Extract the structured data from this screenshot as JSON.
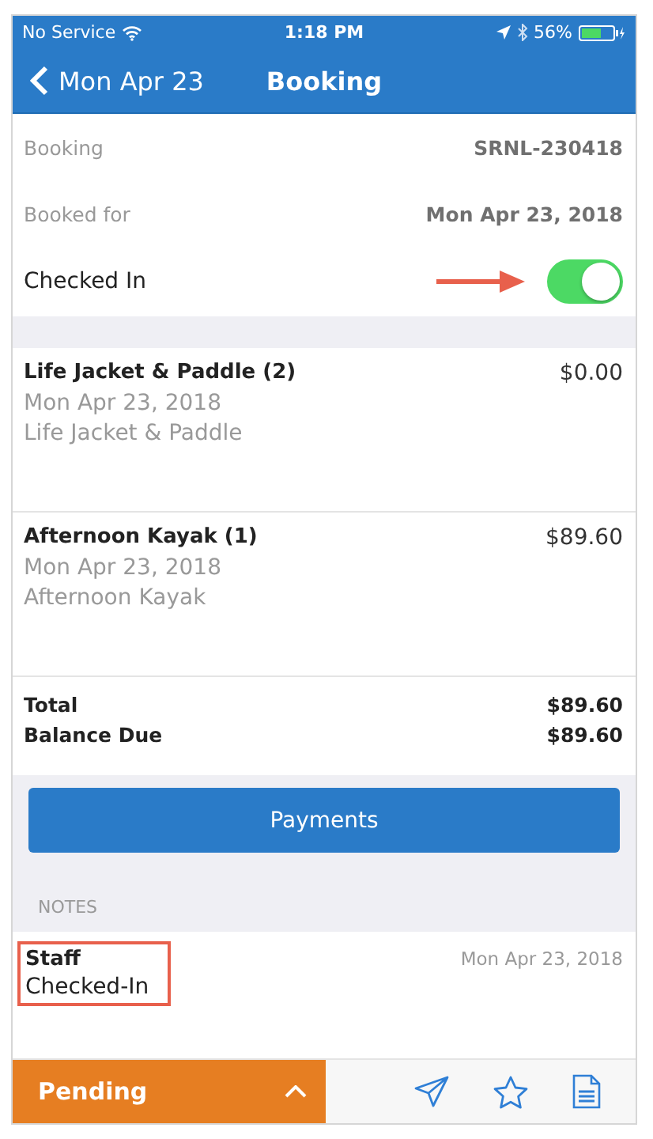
{
  "status_bar": {
    "carrier": "No Service",
    "time": "1:18 PM",
    "battery": "56%"
  },
  "nav": {
    "back_label": "Mon Apr 23",
    "title": "Booking"
  },
  "details": [
    {
      "label": "Booking",
      "value": "SRNL-230418"
    },
    {
      "label": "Booked for",
      "value": "Mon Apr 23, 2018"
    }
  ],
  "checked_in": {
    "label": "Checked In",
    "on": true
  },
  "items": [
    {
      "title": "Life Jacket & Paddle (2)",
      "price": "$0.00",
      "date": "Mon Apr 23, 2018",
      "name": "Life Jacket & Paddle"
    },
    {
      "title": "Afternoon Kayak (1)",
      "price": "$89.60",
      "date": "Mon Apr 23, 2018",
      "name": "Afternoon Kayak"
    }
  ],
  "totals": [
    {
      "label": "Total",
      "value": "$89.60"
    },
    {
      "label": "Balance Due",
      "value": "$89.60"
    }
  ],
  "payments_button": "Payments",
  "notes": {
    "heading": "NOTES",
    "entries": [
      {
        "author": "Staff",
        "text": "Checked-In",
        "date": "Mon Apr 23, 2018"
      }
    ]
  },
  "bottom_bar": {
    "status": "Pending"
  }
}
